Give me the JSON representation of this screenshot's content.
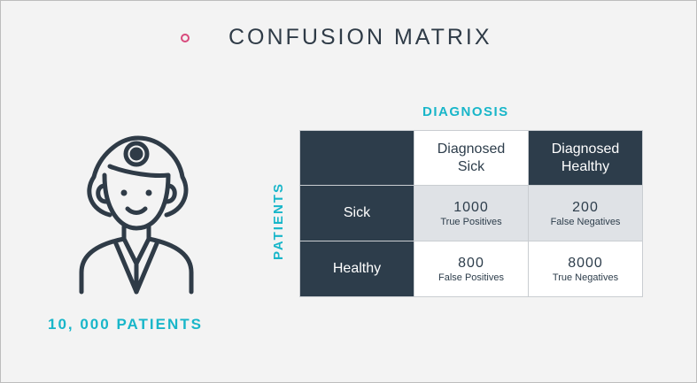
{
  "title": "CONFUSION MATRIX",
  "diagnosis_label": "DIAGNOSIS",
  "patients_label": "PATIENTS",
  "patients_count": "10, 000 PATIENTS",
  "matrix": {
    "col_headers": [
      "Diagnosed Sick",
      "Diagnosed Healthy"
    ],
    "rows": [
      {
        "label": "Sick",
        "cells": [
          {
            "value": "1000",
            "desc": "True Positives"
          },
          {
            "value": "200",
            "desc": "False Negatives"
          }
        ]
      },
      {
        "label": "Healthy",
        "cells": [
          {
            "value": "800",
            "desc": "False Positives"
          },
          {
            "value": "8000",
            "desc": "True Negatives"
          }
        ]
      }
    ]
  },
  "colors": {
    "accent": "#18b6c9",
    "dark": "#2d3d4b",
    "dot": "#d84a7c"
  },
  "icons": [
    "doctor-icon"
  ]
}
